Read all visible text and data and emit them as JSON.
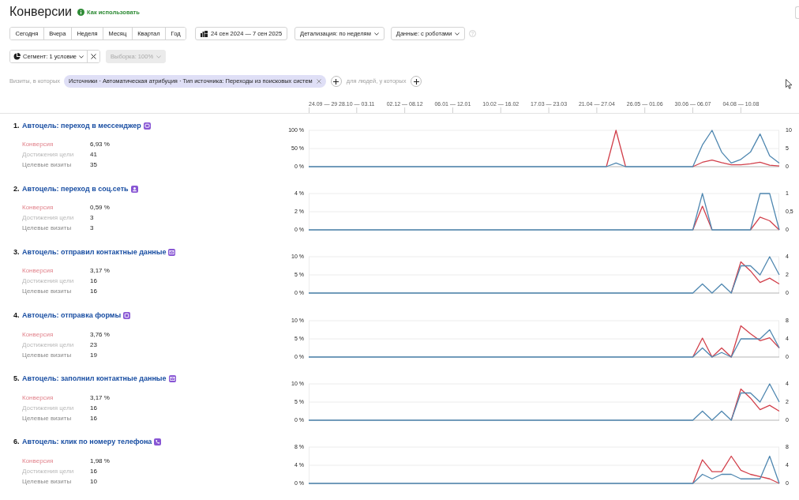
{
  "page": {
    "title": "Конверсии",
    "help_link": "Как использовать"
  },
  "period_tabs": [
    {
      "label": "Сегодня",
      "selected": false
    },
    {
      "label": "Вчера",
      "selected": false
    },
    {
      "label": "Неделя",
      "selected": false
    },
    {
      "label": "Месяц",
      "selected": false
    },
    {
      "label": "Квартал",
      "selected": false
    },
    {
      "label": "Год",
      "selected": false
    }
  ],
  "date_range": "24 сен 2024 — 7 сен 2025",
  "detail_dropdown": "Детализация: по неделям",
  "data_dropdown": "Данные: с роботами",
  "segment": {
    "label": "Сегмент: 1 условие"
  },
  "sample": {
    "label": "Выборка: 100%",
    "disabled": true
  },
  "filter": {
    "prefix": "Визиты, в которых",
    "condition": "Источники · Автоматическая атрибуция · Тип источника: Переходы из поисковых систем",
    "people_label": "для людей, у которых"
  },
  "timeline": {
    "ticks": [
      "24.09 — 29",
      "28.10 — 03.11",
      "02.12 — 08.12",
      "06.01 — 12.01",
      "10.02 — 16.02",
      "17.03 — 23.03",
      "21.04 — 27.04",
      "26.05 — 01.06",
      "30.06 — 06.07",
      "04.08 — 10.08"
    ]
  },
  "goals": [
    {
      "number": "1.",
      "title": "Автоцель: переход в мессенджер",
      "kind": "messenger",
      "stats": [
        {
          "kind": "conversion",
          "label": "Конверсия",
          "value": "6,93 %"
        },
        {
          "kind": "reaches",
          "label": "Достижения цели",
          "value": "41"
        },
        {
          "kind": "visits",
          "label": "Целевые визиты",
          "value": "35"
        }
      ],
      "chart_data": {
        "type": "line",
        "ylim": [
          0,
          100
        ],
        "yticks": [
          {
            "value": 100,
            "label": "100 %"
          },
          {
            "value": 50,
            "label": "50 %"
          },
          {
            "value": 0,
            "label": "0 %"
          }
        ],
        "y2lim": [
          0,
          10
        ],
        "y2ticks": [
          {
            "value": 10,
            "label": "10"
          },
          {
            "value": 5,
            "label": "5"
          },
          {
            "value": 0,
            "label": "0"
          }
        ],
        "series": [
          {
            "color": "#d2404b",
            "values": [
              null,
              null,
              null,
              null,
              null,
              null,
              null,
              null,
              null,
              null,
              null,
              null,
              null,
              null,
              null,
              null,
              null,
              null,
              null,
              null,
              null,
              null,
              null,
              null,
              null,
              null,
              null,
              null,
              null,
              null,
              null,
              0,
              100,
              0,
              null,
              null,
              null,
              null,
              null,
              null,
              0,
              12,
              18,
              11,
              5,
              5,
              8,
              12,
              4,
              2
            ]
          },
          {
            "color": "#4f87b0",
            "axis": "y2",
            "values": [
              0,
              0,
              0,
              0,
              0,
              0,
              0,
              0,
              0,
              0,
              0,
              0,
              0,
              0,
              0,
              0,
              0,
              0,
              0,
              0,
              0,
              0,
              0,
              0,
              0,
              0,
              0,
              0,
              0,
              0,
              0,
              0,
              1,
              0,
              0,
              0,
              0,
              0,
              0,
              0,
              0,
              6,
              10,
              4,
              1,
              2,
              4,
              9,
              3,
              1
            ]
          }
        ]
      }
    },
    {
      "number": "2.",
      "title": "Автоцель: переход в соц.сеть",
      "kind": "social",
      "stats": [
        {
          "kind": "conversion",
          "label": "Конверсия",
          "value": "0,59 %"
        },
        {
          "kind": "reaches",
          "label": "Достижения цели",
          "value": "3"
        },
        {
          "kind": "visits",
          "label": "Целевые визиты",
          "value": "3"
        }
      ],
      "chart_data": {
        "type": "line",
        "ylim": [
          0,
          4
        ],
        "yticks": [
          {
            "value": 4,
            "label": "4 %"
          },
          {
            "value": 2,
            "label": "2 %"
          },
          {
            "value": 0,
            "label": "0 %"
          }
        ],
        "y2lim": [
          0,
          1
        ],
        "y2ticks": [
          {
            "value": 1,
            "label": "1"
          },
          {
            "value": 0.5,
            "label": "0,5"
          },
          {
            "value": 0,
            "label": "0"
          }
        ],
        "series": [
          {
            "color": "#d2404b",
            "values": [
              null,
              null,
              null,
              null,
              null,
              null,
              null,
              null,
              null,
              null,
              null,
              null,
              null,
              null,
              null,
              null,
              null,
              null,
              null,
              null,
              null,
              null,
              null,
              null,
              null,
              null,
              null,
              null,
              null,
              null,
              null,
              null,
              null,
              null,
              null,
              null,
              null,
              null,
              null,
              null,
              0,
              2.6,
              0,
              null,
              null,
              null,
              0,
              1.4,
              1,
              0
            ]
          },
          {
            "color": "#4f87b0",
            "axis": "y2",
            "values": [
              0,
              0,
              0,
              0,
              0,
              0,
              0,
              0,
              0,
              0,
              0,
              0,
              0,
              0,
              0,
              0,
              0,
              0,
              0,
              0,
              0,
              0,
              0,
              0,
              0,
              0,
              0,
              0,
              0,
              0,
              0,
              0,
              0,
              0,
              0,
              0,
              0,
              0,
              0,
              0,
              0,
              1,
              0,
              0,
              0,
              0,
              0,
              1,
              1,
              0
            ]
          }
        ]
      }
    },
    {
      "number": "3.",
      "title": "Автоцель: отправил контактные данные",
      "kind": "contacts",
      "stats": [
        {
          "kind": "conversion",
          "label": "Конверсия",
          "value": "3,17 %"
        },
        {
          "kind": "reaches",
          "label": "Достижения цели",
          "value": "16"
        },
        {
          "kind": "visits",
          "label": "Целевые визиты",
          "value": "16"
        }
      ],
      "chart_data": {
        "type": "line",
        "ylim": [
          0,
          10
        ],
        "yticks": [
          {
            "value": 10,
            "label": "10 %"
          },
          {
            "value": 5,
            "label": "5 %"
          },
          {
            "value": 0,
            "label": "0 %"
          }
        ],
        "y2lim": [
          0,
          4
        ],
        "y2ticks": [
          {
            "value": 4,
            "label": "4"
          },
          {
            "value": 2,
            "label": "2"
          },
          {
            "value": 0,
            "label": "0"
          }
        ],
        "series": [
          {
            "color": "#d2404b",
            "values": [
              null,
              null,
              null,
              null,
              null,
              null,
              null,
              null,
              null,
              null,
              null,
              null,
              null,
              null,
              null,
              null,
              null,
              null,
              null,
              null,
              null,
              null,
              null,
              null,
              null,
              null,
              null,
              null,
              null,
              null,
              null,
              null,
              null,
              null,
              null,
              null,
              null,
              null,
              null,
              null,
              null,
              null,
              null,
              null,
              0,
              8.6,
              6.1,
              2.9,
              4.1,
              2.5
            ]
          },
          {
            "color": "#4f87b0",
            "axis": "y2",
            "values": [
              0,
              0,
              0,
              0,
              0,
              0,
              0,
              0,
              0,
              0,
              0,
              0,
              0,
              0,
              0,
              0,
              0,
              0,
              0,
              0,
              0,
              0,
              0,
              0,
              0,
              0,
              0,
              0,
              0,
              0,
              0,
              0,
              0,
              0,
              0,
              0,
              0,
              0,
              0,
              0,
              0,
              1,
              0,
              1,
              0,
              3,
              3,
              2,
              4,
              2
            ]
          }
        ]
      }
    },
    {
      "number": "4.",
      "title": "Автоцель: отправка формы",
      "kind": "form",
      "stats": [
        {
          "kind": "conversion",
          "label": "Конверсия",
          "value": "3,76 %"
        },
        {
          "kind": "reaches",
          "label": "Достижения цели",
          "value": "23"
        },
        {
          "kind": "visits",
          "label": "Целевые визиты",
          "value": "19"
        }
      ],
      "chart_data": {
        "type": "line",
        "ylim": [
          0,
          10
        ],
        "yticks": [
          {
            "value": 10,
            "label": "10 %"
          },
          {
            "value": 5,
            "label": "5 %"
          },
          {
            "value": 0,
            "label": "0 %"
          }
        ],
        "y2lim": [
          0,
          8
        ],
        "y2ticks": [
          {
            "value": 8,
            "label": "8"
          },
          {
            "value": 4,
            "label": "4"
          },
          {
            "value": 0,
            "label": "0"
          }
        ],
        "series": [
          {
            "color": "#d2404b",
            "values": [
              null,
              null,
              null,
              null,
              null,
              null,
              null,
              null,
              null,
              null,
              null,
              null,
              null,
              null,
              null,
              null,
              null,
              null,
              null,
              null,
              null,
              null,
              null,
              null,
              null,
              null,
              null,
              null,
              null,
              null,
              null,
              null,
              null,
              null,
              null,
              null,
              null,
              null,
              null,
              null,
              0,
              5.2,
              0,
              2.5,
              0,
              8.6,
              6.4,
              4.5,
              5.3,
              2.5
            ]
          },
          {
            "color": "#4f87b0",
            "axis": "y2",
            "values": [
              0,
              0,
              0,
              0,
              0,
              0,
              0,
              0,
              0,
              0,
              0,
              0,
              0,
              0,
              0,
              0,
              0,
              0,
              0,
              0,
              0,
              0,
              0,
              0,
              0,
              0,
              0,
              0,
              0,
              0,
              0,
              0,
              0,
              0,
              0,
              0,
              0,
              0,
              0,
              0,
              0,
              2,
              0,
              1,
              0,
              4,
              4,
              4,
              6,
              2
            ]
          }
        ]
      }
    },
    {
      "number": "5.",
      "title": "Автоцель: заполнил контактные данные",
      "kind": "contacts",
      "stats": [
        {
          "kind": "conversion",
          "label": "Конверсия",
          "value": "3,17 %"
        },
        {
          "kind": "reaches",
          "label": "Достижения цели",
          "value": "16"
        },
        {
          "kind": "visits",
          "label": "Целевые визиты",
          "value": "16"
        }
      ],
      "chart_data": {
        "type": "line",
        "ylim": [
          0,
          10
        ],
        "yticks": [
          {
            "value": 10,
            "label": "10 %"
          },
          {
            "value": 5,
            "label": "5 %"
          },
          {
            "value": 0,
            "label": "0 %"
          }
        ],
        "y2lim": [
          0,
          4
        ],
        "y2ticks": [
          {
            "value": 4,
            "label": "4"
          },
          {
            "value": 2,
            "label": "2"
          },
          {
            "value": 0,
            "label": "0"
          }
        ],
        "series": [
          {
            "color": "#d2404b",
            "values": [
              null,
              null,
              null,
              null,
              null,
              null,
              null,
              null,
              null,
              null,
              null,
              null,
              null,
              null,
              null,
              null,
              null,
              null,
              null,
              null,
              null,
              null,
              null,
              null,
              null,
              null,
              null,
              null,
              null,
              null,
              null,
              null,
              null,
              null,
              null,
              null,
              null,
              null,
              null,
              null,
              null,
              null,
              null,
              null,
              0,
              8.6,
              6.1,
              2.9,
              4.1,
              2.5
            ]
          },
          {
            "color": "#4f87b0",
            "axis": "y2",
            "values": [
              0,
              0,
              0,
              0,
              0,
              0,
              0,
              0,
              0,
              0,
              0,
              0,
              0,
              0,
              0,
              0,
              0,
              0,
              0,
              0,
              0,
              0,
              0,
              0,
              0,
              0,
              0,
              0,
              0,
              0,
              0,
              0,
              0,
              0,
              0,
              0,
              0,
              0,
              0,
              0,
              0,
              1,
              0,
              1,
              0,
              3,
              3,
              2,
              4,
              2
            ]
          }
        ]
      }
    },
    {
      "number": "6.",
      "title": "Автоцель: клик по номеру телефона",
      "kind": "phone",
      "stats": [
        {
          "kind": "conversion",
          "label": "Конверсия",
          "value": "1,98 %"
        },
        {
          "kind": "reaches",
          "label": "Достижения цели",
          "value": "16"
        },
        {
          "kind": "visits",
          "label": "Целевые визиты",
          "value": "10"
        }
      ],
      "chart_data": {
        "type": "line",
        "ylim": [
          0,
          8
        ],
        "yticks": [
          {
            "value": 8,
            "label": "8 %"
          },
          {
            "value": 4,
            "label": "4 %"
          },
          {
            "value": 0,
            "label": "0 %"
          }
        ],
        "y2lim": [
          0,
          8
        ],
        "y2ticks": [
          {
            "value": 8,
            "label": "8"
          },
          {
            "value": 4,
            "label": "4"
          },
          {
            "value": 0,
            "label": "0"
          }
        ],
        "series": [
          {
            "color": "#d2404b",
            "values": [
              null,
              null,
              null,
              null,
              null,
              null,
              null,
              null,
              null,
              null,
              null,
              null,
              null,
              null,
              null,
              null,
              null,
              null,
              null,
              null,
              null,
              null,
              null,
              null,
              null,
              null,
              null,
              null,
              null,
              null,
              null,
              null,
              null,
              null,
              null,
              null,
              null,
              null,
              null,
              null,
              0,
              5.2,
              2.6,
              2.6,
              6,
              2.9,
              2,
              1.5,
              1,
              0
            ]
          },
          {
            "color": "#4f87b0",
            "axis": "y2",
            "values": [
              0,
              0,
              0,
              0,
              0,
              0,
              0,
              0,
              0,
              0,
              0,
              0,
              0,
              0,
              0,
              0,
              0,
              0,
              0,
              0,
              0,
              0,
              0,
              0,
              0,
              0,
              0,
              0,
              0,
              0,
              0,
              0,
              0,
              0,
              0,
              0,
              0,
              0,
              0,
              0,
              0,
              2,
              1,
              2,
              2,
              1,
              1,
              1,
              6,
              0
            ]
          }
        ]
      }
    }
  ]
}
